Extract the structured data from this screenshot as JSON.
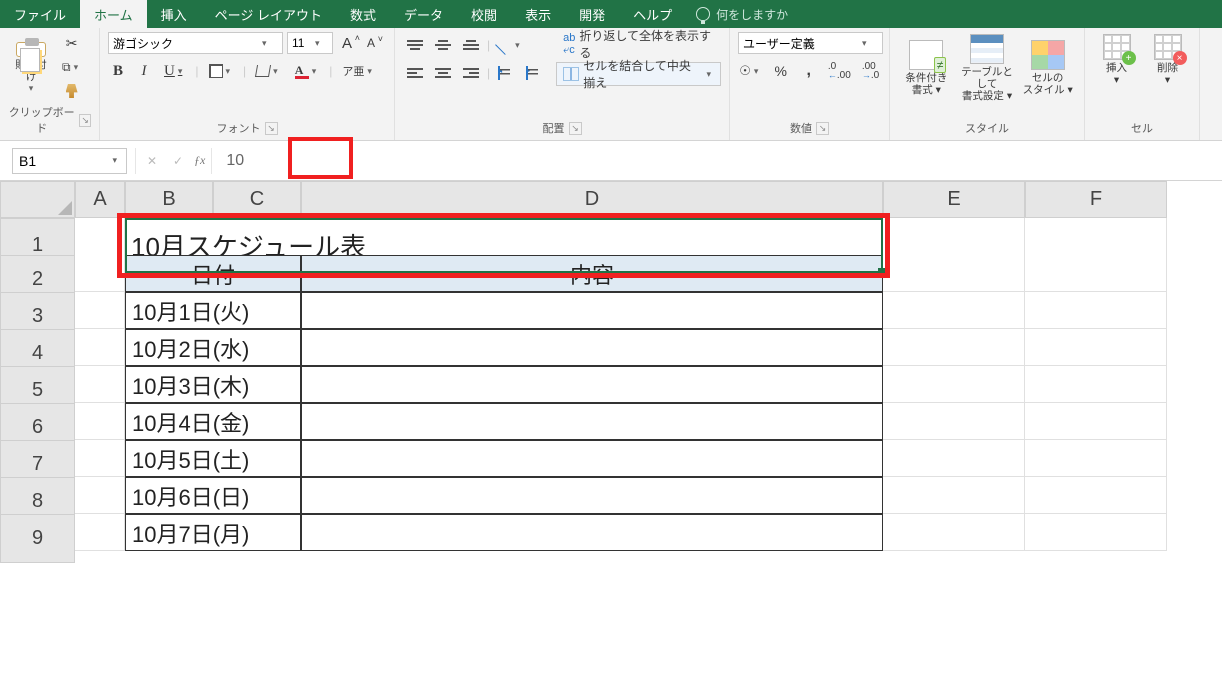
{
  "tabs": {
    "file": "ファイル",
    "home": "ホーム",
    "insert": "挿入",
    "layout": "ページ レイアウト",
    "formulas": "数式",
    "data": "データ",
    "review": "校閲",
    "view": "表示",
    "dev": "開発",
    "help": "ヘルプ",
    "tellme": "何をしますか"
  },
  "ribbon": {
    "clipboard": {
      "paste": "貼り付け",
      "group": "クリップボード"
    },
    "font": {
      "name": "游ゴシック",
      "size": "11",
      "group": "フォント",
      "bold": "B",
      "italic": "I",
      "underline": "U",
      "ruby": "ア亜",
      "bigA": "A",
      "smallA": "A"
    },
    "alignment": {
      "wrap": "折り返して全体を表示する",
      "merge": "セルを結合して中央揃え",
      "group": "配置"
    },
    "number": {
      "format": "ユーザー定義",
      "group": "数値"
    },
    "styles": {
      "cf1": "条件付き",
      "cf2": "書式 ▾",
      "tbl1": "テーブルとして",
      "tbl2": "書式設定 ▾",
      "cell1": "セルの",
      "cell2": "スタイル ▾",
      "group": "スタイル"
    },
    "cells": {
      "insert": "挿入",
      "delete": "削除",
      "group": "セル"
    }
  },
  "formula_bar": {
    "ref": "B1",
    "value": "10"
  },
  "cols": {
    "A": "A",
    "B": "B",
    "C": "C",
    "D": "D",
    "E": "E",
    "F": "F"
  },
  "rows": [
    "1",
    "2",
    "3",
    "4",
    "5",
    "6",
    "7",
    "8",
    "9"
  ],
  "sheet": {
    "title": "10月スケジュール表",
    "h_date": "日付",
    "h_content": "内容",
    "dates": [
      "10月1日(火)",
      "10月2日(水)",
      "10月3日(木)",
      "10月4日(金)",
      "10月5日(土)",
      "10月6日(日)",
      "10月7日(月)"
    ]
  }
}
